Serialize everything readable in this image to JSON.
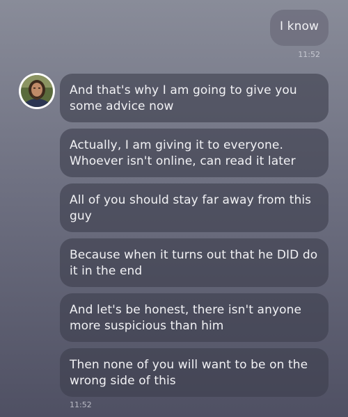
{
  "chat": {
    "outgoing": {
      "text": "I know",
      "time": "11:52"
    },
    "incoming": {
      "avatar_icon": "bearded-man-avatar",
      "messages": [
        "And that's why I am going to give you some advice now",
        "Actually, I am giving it to everyone. Whoever isn't online, can read it later",
        "All of you should stay far away from this guy",
        "Because when it turns out that he DID do it in the end",
        "And let's be honest, there isn't anyone more suspicious than him",
        "Then none of you will want to be on the wrong side of this"
      ],
      "time": "11:52"
    }
  },
  "colors": {
    "background_top": "#898c99",
    "background_bottom": "#4f5063",
    "bubble_incoming": "#3e3f4e",
    "bubble_outgoing": "#6e6f7e",
    "text": "#f2f2f5"
  }
}
